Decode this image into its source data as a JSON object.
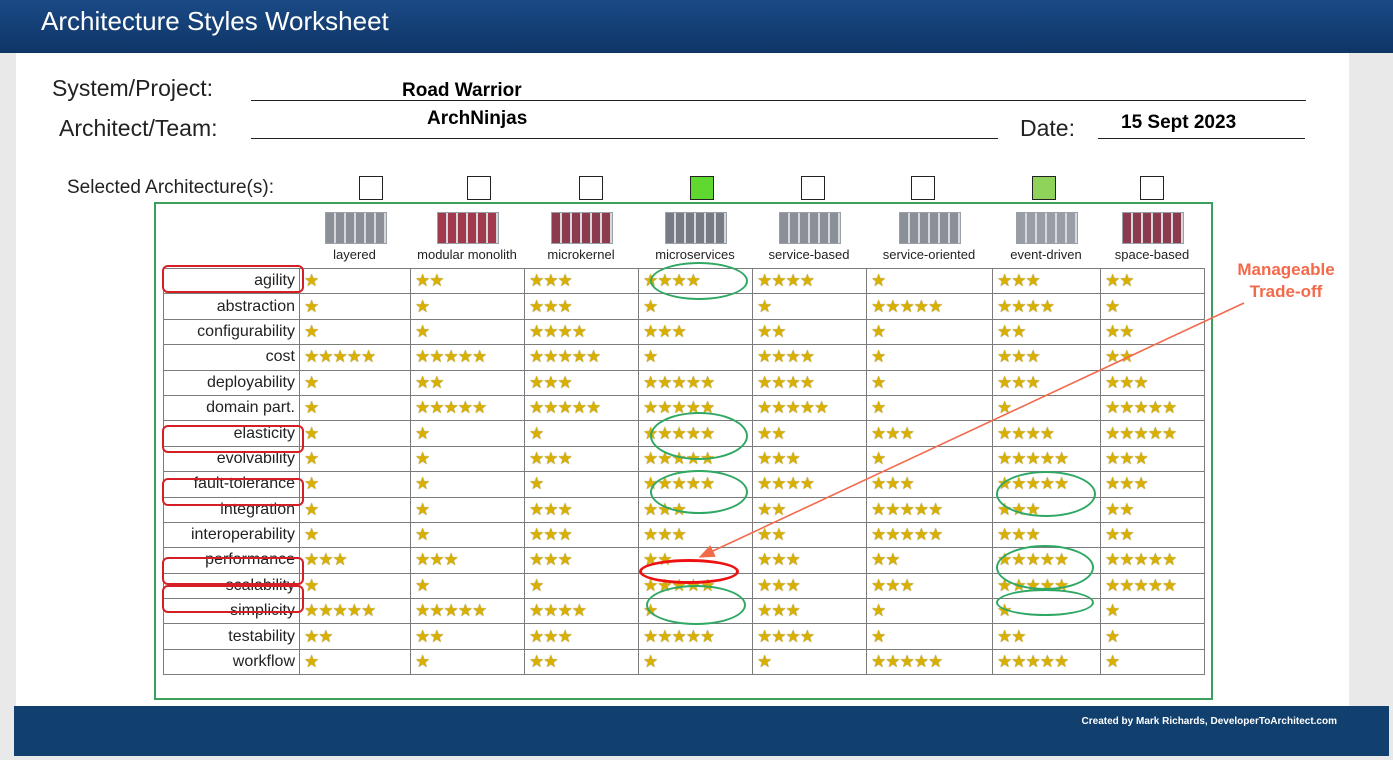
{
  "header": {
    "title": "Architecture Styles Worksheet"
  },
  "form": {
    "system_label": "System/Project:",
    "system_value": "Road Warrior",
    "team_label": "Architect/Team:",
    "team_value": "ArchNinjas",
    "date_label": "Date:",
    "date_value": "15 Sept 2023",
    "selected_label": "Selected Architecture(s):"
  },
  "styles": [
    {
      "name": "layered",
      "selected": false
    },
    {
      "name": "modular monolith",
      "selected": false
    },
    {
      "name": "microkernel",
      "selected": false
    },
    {
      "name": "microservices",
      "selected": true
    },
    {
      "name": "service-based",
      "selected": false
    },
    {
      "name": "service-oriented",
      "selected": false
    },
    {
      "name": "event-driven",
      "selected": true
    },
    {
      "name": "space-based",
      "selected": false
    }
  ],
  "ratings": [
    {
      "attr": "agility",
      "stars": [
        1,
        2,
        3,
        4,
        4,
        1,
        3,
        2
      ],
      "highlight": true
    },
    {
      "attr": "abstraction",
      "stars": [
        1,
        1,
        3,
        1,
        1,
        5,
        4,
        1
      ]
    },
    {
      "attr": "configurability",
      "stars": [
        1,
        1,
        4,
        3,
        2,
        1,
        2,
        2
      ]
    },
    {
      "attr": "cost",
      "stars": [
        5,
        5,
        5,
        1,
        4,
        1,
        3,
        2
      ]
    },
    {
      "attr": "deployability",
      "stars": [
        1,
        2,
        3,
        5,
        4,
        1,
        3,
        3
      ]
    },
    {
      "attr": "domain part.",
      "stars": [
        1,
        5,
        5,
        5,
        5,
        1,
        1,
        5
      ]
    },
    {
      "attr": "elasticity",
      "stars": [
        1,
        1,
        1,
        5,
        2,
        3,
        4,
        5
      ],
      "highlight": true
    },
    {
      "attr": "evolvability",
      "stars": [
        1,
        1,
        3,
        5,
        3,
        1,
        5,
        3
      ]
    },
    {
      "attr": "fault-tolerance",
      "stars": [
        1,
        1,
        1,
        5,
        4,
        3,
        5,
        3
      ],
      "highlight": true
    },
    {
      "attr": "integration",
      "stars": [
        1,
        1,
        3,
        3,
        2,
        5,
        3,
        2
      ]
    },
    {
      "attr": "interoperability",
      "stars": [
        1,
        1,
        3,
        3,
        2,
        5,
        3,
        2
      ]
    },
    {
      "attr": "performance",
      "stars": [
        3,
        3,
        3,
        2,
        3,
        2,
        5,
        5
      ],
      "highlight": true
    },
    {
      "attr": "scalability",
      "stars": [
        1,
        1,
        1,
        5,
        3,
        3,
        5,
        5
      ],
      "highlight": true
    },
    {
      "attr": "simplicity",
      "stars": [
        5,
        5,
        4,
        1,
        3,
        1,
        1,
        1
      ]
    },
    {
      "attr": "testability",
      "stars": [
        2,
        2,
        3,
        5,
        4,
        1,
        2,
        1
      ]
    },
    {
      "attr": "workflow",
      "stars": [
        1,
        1,
        2,
        1,
        1,
        5,
        5,
        1
      ]
    }
  ],
  "annotation": {
    "line1": "Manageable",
    "line2": "Trade-off"
  },
  "footer": {
    "credit": "Created by Mark Richards, DeveloperToArchitect.com"
  },
  "colors": {
    "header": "#153f75",
    "frame": "#3aa15c",
    "highlight_red": "#d61f25",
    "note": "#f36a4b",
    "checked": "#5fd92f"
  }
}
